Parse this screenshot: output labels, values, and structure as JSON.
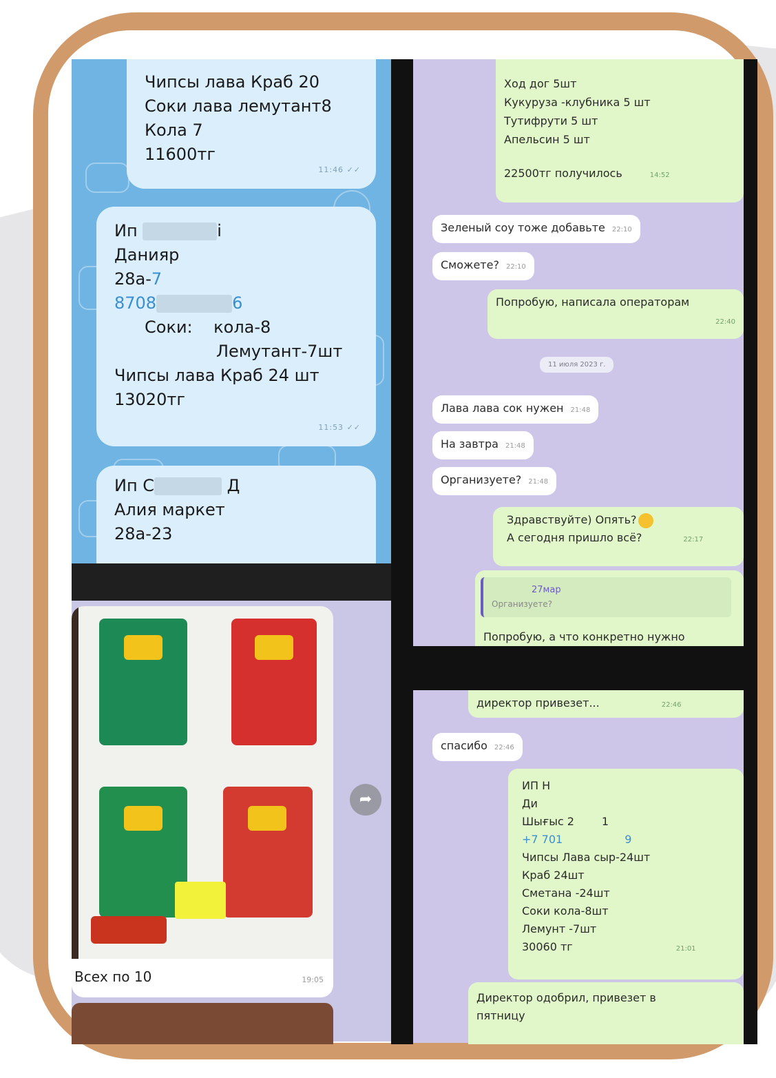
{
  "left_top_chat": {
    "bubble1": {
      "lines": [
        "Чипсы лава Краб 20",
        "Соки лава лемутант8",
        "Кола 7",
        "11600тг"
      ],
      "time": "11:46"
    },
    "bubble2": {
      "line1_prefix": "Ип",
      "line1_suffix": "і",
      "line2": "Данияр",
      "line3_a": "28а-",
      "line3_b": "7",
      "line4_a": "8708",
      "line4_b": "6",
      "line5_a": "Соки:",
      "line5_b": "кола-8",
      "line6": "Лемутант-7шт",
      "line7": "Чипсы лава Краб 24 шт",
      "line8": "13020тг",
      "time": "11:53"
    },
    "bubble3": {
      "line1_prefix": "Ип С",
      "line1_suffix": "Д",
      "line2": "Алия маркет",
      "line3": "28а-23"
    }
  },
  "left_bottom_chat": {
    "caption": "Всех по 10",
    "caption_time": "19:05"
  },
  "right_top_chat": {
    "order_lines": [
      "Ход дог 5шт",
      "Кукуруза -клубника 5 шт",
      "Тутифрути 5 шт",
      "Апельсин 5 шт"
    ],
    "order_total": "22500тг получилось",
    "order_time": "14:52",
    "m1": {
      "text": "Зеленый соу тоже добавьте",
      "time": "22:10"
    },
    "m2": {
      "text": "Сможете?",
      "time": "22:10"
    },
    "m3": {
      "text": "Попробую, написала операторам",
      "time": "22:40"
    },
    "date_chip": "11 июля 2023 г.",
    "m4": {
      "text": "Лава лава сок нужен",
      "time": "21:48"
    },
    "m5": {
      "text": "На завтра",
      "time": "21:48"
    },
    "m6": {
      "text": "Организуете?",
      "time": "21:48"
    },
    "m7": {
      "line1": "Здравствуйте) Опять?",
      "line2": "А сегодня пришло всё?",
      "time": "22:17"
    },
    "reply": {
      "author": "27мар",
      "quoted": "Организуете?",
      "text": "Попробую, а что конкретно нужно"
    }
  },
  "right_bottom_chat": {
    "top_text": "директор привезет...",
    "top_time": "22:46",
    "thanks": {
      "text": "спасибо",
      "time": "22:46"
    },
    "order": {
      "l1": "ИП Н",
      "l2": "Ди",
      "l3": "Шығыс 2",
      "l3b": "1",
      "l4": "+7 701",
      "l4b": "9",
      "l5": "Чипсы Лава сыр-24шт",
      "l6": "Краб 24шт",
      "l7": "Сметана -24шт",
      "l8": "Соки кола-8шт",
      "l9": "Лемунт -7шт",
      "l10": "30060 тг",
      "time": "21:01"
    },
    "final": {
      "line1": "Директор одобрил, привезет в",
      "line2": "пятницу"
    }
  },
  "colors": {
    "frame": "#d09a6b",
    "telegram_bg": "#6fb4e2",
    "whatsapp_bg": "#cdc6e9",
    "outgoing": "#e1f7c9",
    "incoming": "#ffffff"
  }
}
